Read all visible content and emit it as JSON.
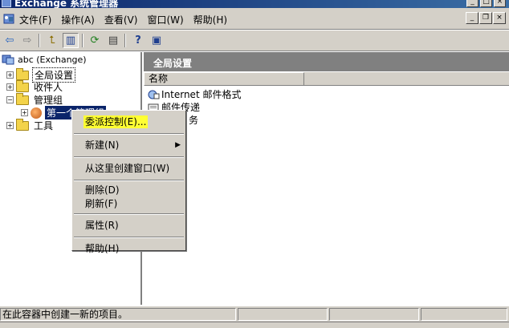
{
  "window": {
    "title": "Exchange 系统管理器",
    "minimize_glyph": "_",
    "maximize_glyph": "□",
    "close_glyph": "×"
  },
  "menubar": {
    "items": [
      {
        "label": "文件(F)"
      },
      {
        "label": "操作(A)"
      },
      {
        "label": "查看(V)"
      },
      {
        "label": "窗口(W)"
      },
      {
        "label": "帮助(H)"
      }
    ],
    "mdi_minimize": "_",
    "mdi_restore": "❐",
    "mdi_close": "×"
  },
  "toolbar": {
    "buttons": [
      {
        "icon": "back-arrow-icon",
        "glyph": "⇦"
      },
      {
        "icon": "forward-arrow-icon",
        "glyph": "⇨"
      },
      {
        "icon": "up-folder-icon",
        "glyph": "⮤"
      },
      {
        "icon": "show-tree-icon",
        "glyph": "▥"
      },
      {
        "icon": "refresh-icon",
        "glyph": "⟳"
      },
      {
        "icon": "export-list-icon",
        "glyph": "▤"
      },
      {
        "icon": "help-icon",
        "glyph": "?"
      },
      {
        "icon": "show-action-pane-icon",
        "glyph": "▣"
      }
    ]
  },
  "tree": {
    "root_label": "abc (Exchange)",
    "nodes": [
      {
        "label": "全局设置",
        "expander": "+"
      },
      {
        "label": "收件人",
        "expander": "+"
      },
      {
        "label": "管理组",
        "expander": "−"
      },
      {
        "label": "第一个管理组",
        "expander": "+"
      },
      {
        "label": "工具",
        "expander": "+"
      }
    ]
  },
  "right_pane": {
    "header": "全局设置",
    "column_name": "名称",
    "items": [
      {
        "label": "Internet 邮件格式"
      },
      {
        "label": "邮件传递"
      },
      {
        "label": "务"
      }
    ]
  },
  "context_menu": {
    "items": [
      {
        "label": "委派控制(E)..."
      },
      {
        "label": "新建(N)",
        "arrow": "▶"
      },
      {
        "label": "从这里创建窗口(W)"
      },
      {
        "label": "删除(D)"
      },
      {
        "label": "刷新(F)"
      },
      {
        "label": "属性(R)"
      },
      {
        "label": "帮助(H)"
      }
    ]
  },
  "statusbar": {
    "text": "在此容器中创建一新的项目。"
  }
}
